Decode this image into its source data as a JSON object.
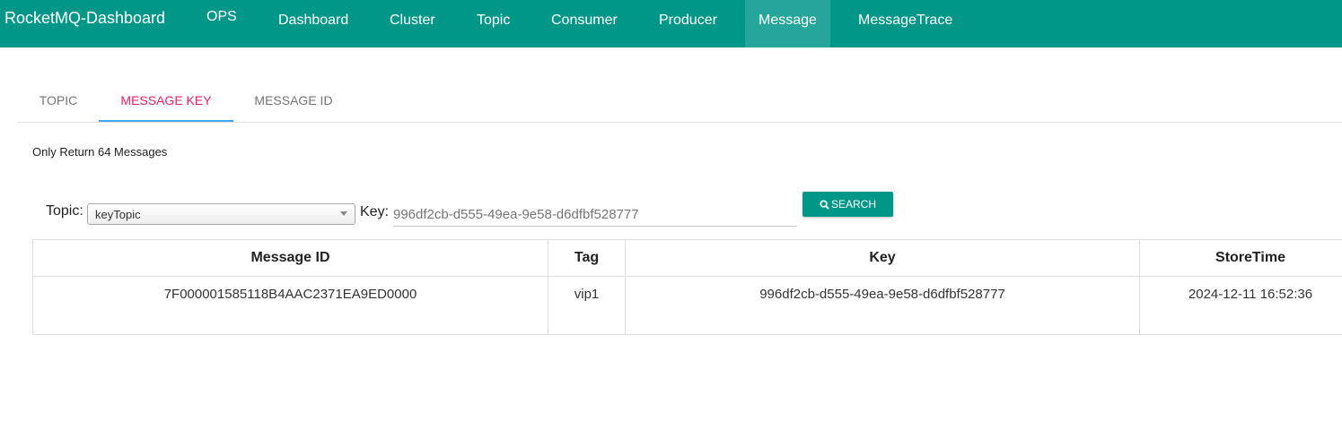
{
  "nav": {
    "brand": "RocketMQ-Dashboard",
    "items": [
      "OPS",
      "Dashboard",
      "Cluster",
      "Topic",
      "Consumer",
      "Producer",
      "Message",
      "MessageTrace"
    ],
    "active": "Message"
  },
  "tabs": [
    "TOPIC",
    "MESSAGE KEY",
    "MESSAGE ID"
  ],
  "active_tab": "MESSAGE KEY",
  "note": "Only Return 64 Messages",
  "form": {
    "topic_label": "Topic:",
    "topic_value": "keyTopic",
    "key_label": "Key:",
    "key_placeholder": "996df2cb-d555-49ea-9e58-d6dfbf528777",
    "search_label": "SEARCH"
  },
  "table": {
    "headers": [
      "Message ID",
      "Tag",
      "Key",
      "StoreTime"
    ],
    "rows": [
      [
        "7F000001585118B4AAC2371EA9ED0000",
        "vip1",
        "996df2cb-d555-49ea-9e58-d6dfbf528777",
        "2024-12-11 16:52:36"
      ]
    ]
  },
  "colors": {
    "primary": "#009688",
    "active_nav": "#26a69a",
    "active_tab_text": "#e91e63",
    "tab_indicator": "#42a5f5"
  }
}
